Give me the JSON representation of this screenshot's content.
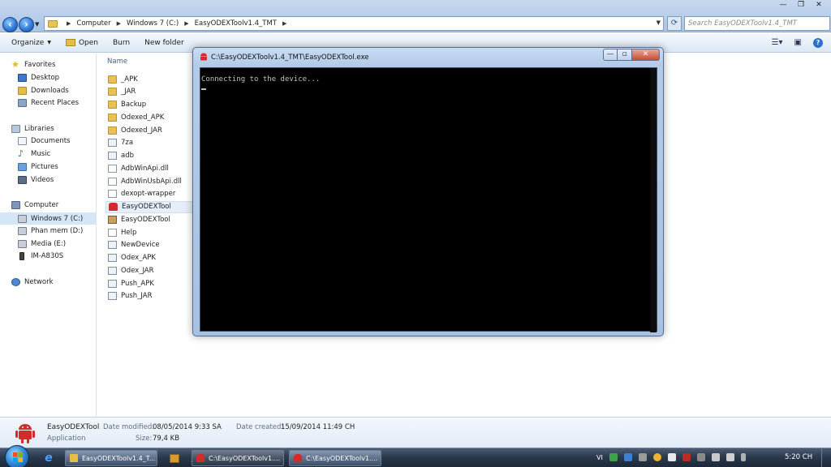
{
  "explorer": {
    "breadcrumb": [
      "Computer",
      "Windows 7 (C:)",
      "EasyODEXToolv1.4_TMT"
    ],
    "search_placeholder": "Search EasyODEXToolv1.4_TMT",
    "toolbar": {
      "organize": "Organize",
      "open": "Open",
      "burn": "Burn",
      "new_folder": "New folder"
    },
    "nav": {
      "favorites": "Favorites",
      "favorites_items": [
        "Desktop",
        "Downloads",
        "Recent Places"
      ],
      "libraries": "Libraries",
      "libraries_items": [
        "Documents",
        "Music",
        "Pictures",
        "Videos"
      ],
      "computer": "Computer",
      "computer_items": [
        "Windows 7 (C:)",
        "Phan mem (D:)",
        "Media (E:)",
        "IM-A830S"
      ],
      "network": "Network"
    },
    "column_name": "Name",
    "files": [
      {
        "name": "_APK",
        "type": "folder"
      },
      {
        "name": "_JAR",
        "type": "folder"
      },
      {
        "name": "Backup",
        "type": "folder"
      },
      {
        "name": "Odexed_APK",
        "type": "folder"
      },
      {
        "name": "Odexed_JAR",
        "type": "folder"
      },
      {
        "name": "7za",
        "type": "exe"
      },
      {
        "name": "adb",
        "type": "exe"
      },
      {
        "name": "AdbWinApi.dll",
        "type": "file"
      },
      {
        "name": "AdbWinUsbApi.dll",
        "type": "file"
      },
      {
        "name": "dexopt-wrapper",
        "type": "file"
      },
      {
        "name": "EasyODEXTool",
        "type": "android"
      },
      {
        "name": "EasyODEXTool",
        "type": "archive"
      },
      {
        "name": "Help",
        "type": "file"
      },
      {
        "name": "NewDevice",
        "type": "exe"
      },
      {
        "name": "Odex_APK",
        "type": "exe"
      },
      {
        "name": "Odex_JAR",
        "type": "exe"
      },
      {
        "name": "Push_APK",
        "type": "exe"
      },
      {
        "name": "Push_JAR",
        "type": "exe"
      }
    ],
    "details": {
      "name": "EasyODEXTool",
      "kind": "Application",
      "date_modified_label": "Date modified:",
      "date_modified": "08/05/2014 9:33 SA",
      "size_label": "Size:",
      "size": "79,4 KB",
      "date_created_label": "Date created:",
      "date_created": "15/09/2014 11:49 CH"
    }
  },
  "console": {
    "title": "C:\\EasyODEXToolv1.4_TMT\\EasyODEXTool.exe",
    "output": "Connecting to the device..."
  },
  "taskbar": {
    "tasks": [
      {
        "label": "EasyODEXToolv1.4_T..."
      },
      {
        "label": "C:\\EasyODEXToolv1...."
      },
      {
        "label": "C:\\EasyODEXToolv1...."
      }
    ],
    "language": "VI",
    "time": "5:20 CH"
  },
  "colors": {
    "console_bg": "#000000",
    "console_text": "#c0c0c0",
    "selection": "#d4e6f8",
    "taskbar": "#2c3a4e"
  }
}
